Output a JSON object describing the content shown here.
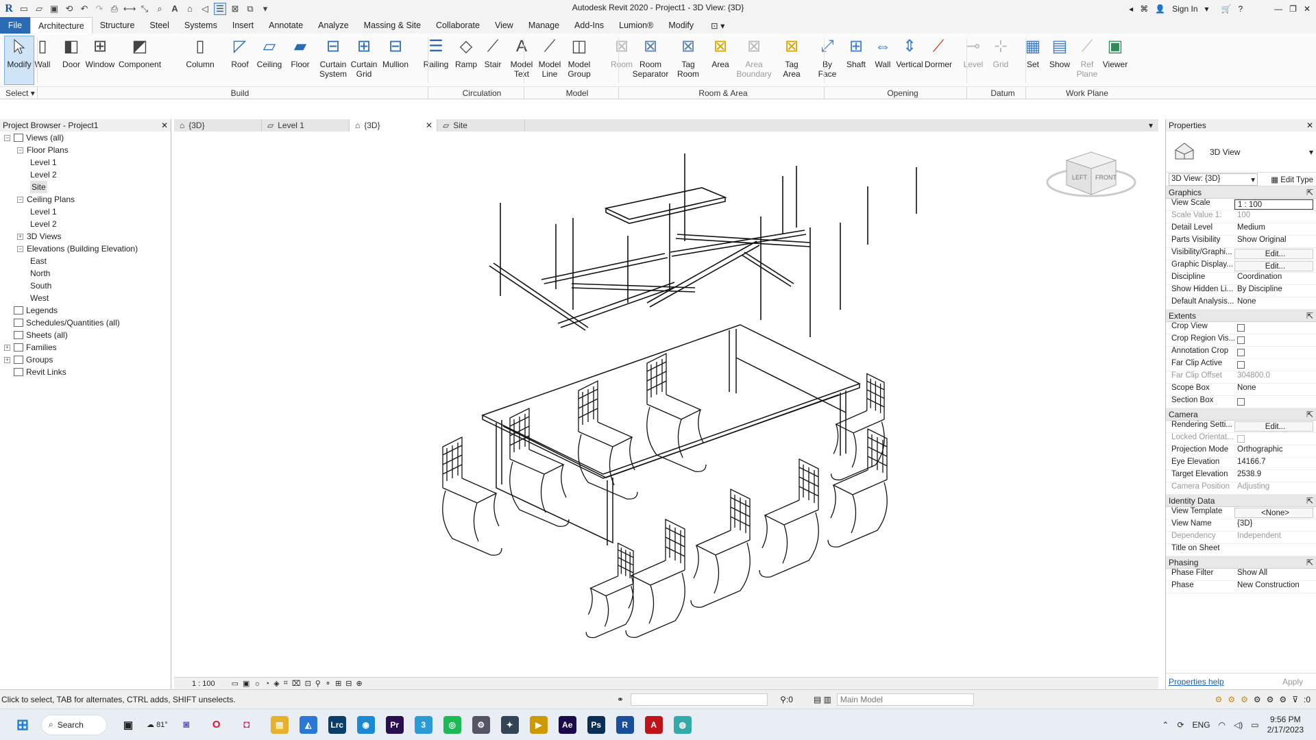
{
  "window": {
    "title": "Autodesk Revit 2020 - Project1 - 3D View: {3D}",
    "sign_in": "Sign In"
  },
  "menu_tabs": [
    "File",
    "Architecture",
    "Structure",
    "Steel",
    "Systems",
    "Insert",
    "Annotate",
    "Analyze",
    "Massing & Site",
    "Collaborate",
    "View",
    "Manage",
    "Add-Ins",
    "Lumion®",
    "Modify"
  ],
  "ribbon": {
    "modify": "Modify",
    "select": "Select",
    "buttons": [
      {
        "label": "Wall",
        "icon": "wall-icon"
      },
      {
        "label": "Door",
        "icon": "door-icon"
      },
      {
        "label": "Window",
        "icon": "window-icon"
      },
      {
        "label": "Component",
        "icon": "component-icon"
      },
      {
        "label": "Column",
        "icon": "column-icon"
      },
      {
        "label": "Roof",
        "icon": "roof-icon"
      },
      {
        "label": "Ceiling",
        "icon": "ceiling-icon"
      },
      {
        "label": "Floor",
        "icon": "floor-icon"
      },
      {
        "label": "Curtain\nSystem",
        "icon": "curtain-system-icon"
      },
      {
        "label": "Curtain\nGrid",
        "icon": "curtain-grid-icon"
      },
      {
        "label": "Mullion",
        "icon": "mullion-icon"
      },
      {
        "label": "Railing",
        "icon": "railing-icon"
      },
      {
        "label": "Ramp",
        "icon": "ramp-icon"
      },
      {
        "label": "Stair",
        "icon": "stair-icon"
      },
      {
        "label": "Model\nText",
        "icon": "model-text-icon"
      },
      {
        "label": "Model\nLine",
        "icon": "model-line-icon"
      },
      {
        "label": "Model\nGroup",
        "icon": "model-group-icon"
      },
      {
        "label": "Room",
        "icon": "room-icon",
        "disabled": true
      },
      {
        "label": "Room\nSeparator",
        "icon": "room-separator-icon"
      },
      {
        "label": "Tag\nRoom",
        "icon": "tag-room-icon"
      },
      {
        "label": "Area",
        "icon": "area-icon"
      },
      {
        "label": "Area\nBoundary",
        "icon": "area-boundary-icon",
        "disabled": true
      },
      {
        "label": "Tag\nArea",
        "icon": "tag-area-icon"
      },
      {
        "label": "By\nFace",
        "icon": "by-face-icon"
      },
      {
        "label": "Shaft",
        "icon": "shaft-icon"
      },
      {
        "label": "Wall",
        "icon": "opening-wall-icon"
      },
      {
        "label": "Vertical",
        "icon": "vertical-icon"
      },
      {
        "label": "Dormer",
        "icon": "dormer-icon"
      },
      {
        "label": "Level",
        "icon": "level-icon",
        "disabled": true
      },
      {
        "label": "Grid",
        "icon": "grid-icon",
        "disabled": true
      },
      {
        "label": "Set",
        "icon": "set-icon"
      },
      {
        "label": "Show",
        "icon": "show-icon"
      },
      {
        "label": "Ref\nPlane",
        "icon": "ref-plane-icon",
        "disabled": true
      },
      {
        "label": "Viewer",
        "icon": "viewer-icon"
      }
    ],
    "panels": [
      "Build",
      "Circulation",
      "Model",
      "Room & Area",
      "Opening",
      "Datum",
      "Work Plane"
    ]
  },
  "project_browser": {
    "title": "Project Browser - Project1",
    "items": [
      {
        "label": "Views (all)",
        "level": 0,
        "toggle": "−"
      },
      {
        "label": "Floor Plans",
        "level": 1,
        "toggle": "−"
      },
      {
        "label": "Level 1",
        "level": 2
      },
      {
        "label": "Level 2",
        "level": 2
      },
      {
        "label": "Site",
        "level": 2,
        "selected": true
      },
      {
        "label": "Ceiling Plans",
        "level": 1,
        "toggle": "−"
      },
      {
        "label": "Level 1",
        "level": 2
      },
      {
        "label": "Level 2",
        "level": 2
      },
      {
        "label": "3D Views",
        "level": 1,
        "toggle": "+"
      },
      {
        "label": "Elevations (Building Elevation)",
        "level": 1,
        "toggle": "−"
      },
      {
        "label": "East",
        "level": 2
      },
      {
        "label": "North",
        "level": 2
      },
      {
        "label": "South",
        "level": 2
      },
      {
        "label": "West",
        "level": 2
      },
      {
        "label": "Legends",
        "level": 0,
        "icon": true
      },
      {
        "label": "Schedules/Quantities (all)",
        "level": 0,
        "icon": true
      },
      {
        "label": "Sheets (all)",
        "level": 0,
        "icon": true
      },
      {
        "label": "Families",
        "level": 0,
        "toggle": "+",
        "icon": true
      },
      {
        "label": "Groups",
        "level": 0,
        "toggle": "+",
        "icon": true
      },
      {
        "label": "Revit Links",
        "level": 0,
        "icon": true
      }
    ]
  },
  "view_tabs": [
    {
      "label": "{3D}",
      "active": false
    },
    {
      "label": "Level 1",
      "active": false
    },
    {
      "label": "{3D}",
      "active": true
    },
    {
      "label": "Site",
      "active": false
    }
  ],
  "view_scale": "1 : 100",
  "viewcube": {
    "left": "LEFT",
    "front": "FRONT"
  },
  "properties": {
    "title": "Properties",
    "type": "3D View",
    "selector": "3D View: {3D}",
    "edit_type": "Edit Type",
    "groups": [
      {
        "name": "Graphics",
        "rows": [
          {
            "k": "View Scale",
            "v": "1 : 100"
          },
          {
            "k": "Scale Value    1:",
            "v": "100",
            "dis": true
          },
          {
            "k": "Detail Level",
            "v": "Medium"
          },
          {
            "k": "Parts Visibility",
            "v": "Show Original"
          },
          {
            "k": "Visibility/Graphi...",
            "v": "Edit...",
            "btn": true
          },
          {
            "k": "Graphic Display...",
            "v": "Edit...",
            "btn": true
          },
          {
            "k": "Discipline",
            "v": "Coordination"
          },
          {
            "k": "Show Hidden Li...",
            "v": "By Discipline"
          },
          {
            "k": "Default Analysis...",
            "v": "None"
          }
        ]
      },
      {
        "name": "Extents",
        "rows": [
          {
            "k": "Crop View",
            "cb": true
          },
          {
            "k": "Crop Region Vis...",
            "cb": true
          },
          {
            "k": "Annotation Crop",
            "cb": true
          },
          {
            "k": "Far Clip Active",
            "cb": true
          },
          {
            "k": "Far Clip Offset",
            "v": "304800.0",
            "dis": true
          },
          {
            "k": "Scope Box",
            "v": "None"
          },
          {
            "k": "Section Box",
            "cb": true
          }
        ]
      },
      {
        "name": "Camera",
        "rows": [
          {
            "k": "Rendering Setti...",
            "v": "Edit...",
            "btn": true
          },
          {
            "k": "Locked Orientat...",
            "cb": true,
            "dis": true
          },
          {
            "k": "Projection Mode",
            "v": "Orthographic"
          },
          {
            "k": "Eye Elevation",
            "v": "14166.7"
          },
          {
            "k": "Target Elevation",
            "v": "2538.9"
          },
          {
            "k": "Camera Position",
            "v": "Adjusting",
            "dis": true
          }
        ]
      },
      {
        "name": "Identity Data",
        "rows": [
          {
            "k": "View Template",
            "v": "<None>",
            "btn": true
          },
          {
            "k": "View Name",
            "v": "{3D}"
          },
          {
            "k": "Dependency",
            "v": "Independent",
            "dis": true
          },
          {
            "k": "Title on Sheet",
            "v": ""
          }
        ]
      },
      {
        "name": "Phasing",
        "rows": [
          {
            "k": "Phase Filter",
            "v": "Show All"
          },
          {
            "k": "Phase",
            "v": "New Construction"
          }
        ]
      }
    ],
    "help": "Properties help",
    "apply": "Apply"
  },
  "status": {
    "hint": "Click to select, TAB for alternates, CTRL adds, SHIFT unselects.",
    "zero": ":0",
    "model": "Main Model",
    "filter": ":0"
  },
  "taskbar": {
    "search": "Search",
    "temp": "81°",
    "lang": "ENG",
    "time": "9:56 PM",
    "date": "2/17/2023",
    "apps": [
      {
        "name": "file-explorer-icon",
        "glyph": "▤",
        "color": "#e8b12b"
      },
      {
        "name": "photos-icon",
        "glyph": "◭",
        "color": "#2b78d4"
      },
      {
        "name": "lightroom-icon",
        "glyph": "Lrc",
        "color": "#0b3d6b"
      },
      {
        "name": "edge-icon",
        "glyph": "◉",
        "color": "#1a8ad4"
      },
      {
        "name": "premiere-icon",
        "glyph": "Pr",
        "color": "#2a0f4e"
      },
      {
        "name": "app-3-icon",
        "glyph": "3",
        "color": "#2a9bd6"
      },
      {
        "name": "spotify-icon",
        "glyph": "◎",
        "color": "#1db954"
      },
      {
        "name": "app-gear-icon",
        "glyph": "⚙",
        "color": "#556"
      },
      {
        "name": "app-steam-icon",
        "glyph": "✦",
        "color": "#345"
      },
      {
        "name": "app-media-icon",
        "glyph": "▶",
        "color": "#c90"
      },
      {
        "name": "after-effects-icon",
        "glyph": "Ae",
        "color": "#1a0a4a"
      },
      {
        "name": "photoshop-icon",
        "glyph": "Ps",
        "color": "#0a2f55"
      },
      {
        "name": "revit-icon",
        "glyph": "R",
        "color": "#1a4f9c"
      },
      {
        "name": "acrobat-icon",
        "glyph": "A",
        "color": "#c0141b"
      },
      {
        "name": "app-globe-icon",
        "glyph": "◍",
        "color": "#3aa"
      }
    ]
  }
}
